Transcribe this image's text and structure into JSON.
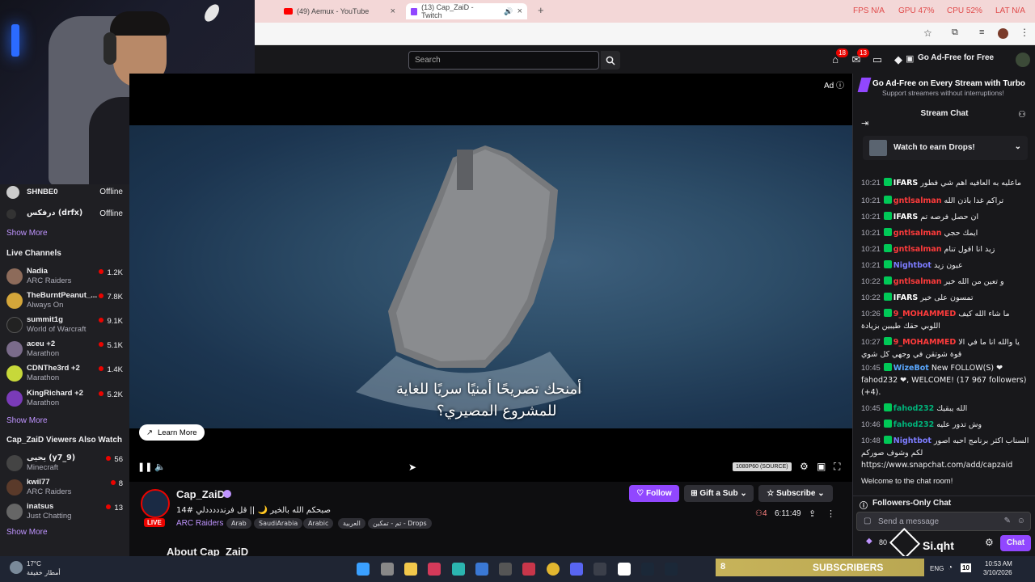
{
  "browser": {
    "tabs": [
      {
        "title": "(49) Aemux - YouTube"
      },
      {
        "title": "(13) Cap_ZaiD - Twitch"
      }
    ],
    "perf": {
      "fps": "FPS N/A",
      "gpu": "GPU 47%",
      "cpu": "CPU 52%",
      "lat": "LAT N/A"
    }
  },
  "header": {
    "search_placeholder": "Search",
    "notif_badge_1": "18",
    "notif_badge_2": "13",
    "adfree_label": "Go Ad-Free for Free"
  },
  "sidebar": {
    "followed": [
      {
        "name": "SHNBE0",
        "status": "Offline"
      },
      {
        "name": "درفكس (drfx)",
        "status": "Offline"
      }
    ],
    "show_more": "Show More",
    "live_heading": "Live Channels",
    "live": [
      {
        "name": "Nadia",
        "game": "ARC Raiders",
        "viewers": "1.2K"
      },
      {
        "name": "TheBurntPeanut_...",
        "game": "Always On",
        "viewers": "7.8K"
      },
      {
        "name": "summit1g",
        "game": "World of Warcraft",
        "viewers": "9.1K"
      },
      {
        "name": "aceu +2",
        "game": "Marathon",
        "viewers": "5.1K"
      },
      {
        "name": "CDNThe3rd +2",
        "game": "Marathon",
        "viewers": "1.4K"
      },
      {
        "name": "KingRichard +2",
        "game": "Marathon",
        "viewers": "5.2K"
      }
    ],
    "also_heading": "Cap_ZaiD Viewers Also Watch",
    "also": [
      {
        "name": "يحيى (y7_9)",
        "game": "Minecraft",
        "viewers": "56"
      },
      {
        "name": "kwil77",
        "game": "ARC Raiders",
        "viewers": "8"
      },
      {
        "name": "inatsus",
        "game": "Just Chatting",
        "viewers": "13"
      }
    ]
  },
  "player": {
    "ad_label": "Ad",
    "caption_line1": "أمنحك تصريحًا أمنيًا سريًا للغاية",
    "caption_line2": "للمشروع المصيري؟",
    "learn_more": "Learn More",
    "quality": "1080P60 (SOURCE)"
  },
  "channel": {
    "name": "Cap_ZaiD",
    "live": "LIVE",
    "title": "صبحكم الله بالخير 🌙 || قل فرندددددلي #14",
    "category": "ARC Raiders",
    "tags": [
      "Arab",
      "SaudiArabia",
      "Arabic",
      "العربية",
      "تم - تمكين - Drops"
    ],
    "follow": "Follow",
    "gift_sub": "Gift a Sub",
    "subscribe": "Subscribe",
    "viewers": "4",
    "uptime": "6:11:49",
    "about": "About Cap_ZaiD"
  },
  "chat": {
    "turbo_title": "Go Ad-Free on Every Stream with Turbo",
    "turbo_sub": "Support streamers without interruptions!",
    "title": "Stream Chat",
    "drops": "Watch to earn Drops!",
    "messages": [
      {
        "time": "10:21",
        "user": "IFARS",
        "color": "#ffffff",
        "text": "ماعليه به العافيه اهم شي فطور"
      },
      {
        "time": "10:21",
        "user": "gntlsalman",
        "color": "#ff3b3b",
        "text": "تراكم غدا باذن الله"
      },
      {
        "time": "10:21",
        "user": "IFARS",
        "color": "#ffffff",
        "text": "ان حصل فرصه تم"
      },
      {
        "time": "10:21",
        "user": "gntlsalman",
        "color": "#ff3b3b",
        "text": "ايمك حجي"
      },
      {
        "time": "10:21",
        "user": "gntlsalman",
        "color": "#ff3b3b",
        "text": "زيد انا اقول تنام"
      },
      {
        "time": "10:21",
        "user": "Nightbot",
        "color": "#7c7cff",
        "text": "عيون زيد"
      },
      {
        "time": "10:22",
        "user": "gntlsalman",
        "color": "#ff3b3b",
        "text": "و تعين من الله خير"
      },
      {
        "time": "10:22",
        "user": "IFARS",
        "color": "#ffffff",
        "text": "تمسون على خير"
      },
      {
        "time": "10:26",
        "user": "9_MOHAMMED",
        "color": "#ff3b3b",
        "text": "ما شاء الله كيف اللوبي حقك طيبين بزيادة"
      },
      {
        "time": "10:27",
        "user": "9_MOHAMMED",
        "color": "#ff3b3b",
        "text": "يا والله انا ما في الا قوة شوتقن في وجهي كل شوي"
      },
      {
        "time": "10:45",
        "user": "WizeBot",
        "color": "#5aa8ff",
        "text": "New FOLLOW(S) ❤ fahod232 ❤, WELCOME! (17 967 followers) (+4)."
      },
      {
        "time": "10:45",
        "user": "fahod232",
        "color": "#00b37a",
        "text": "الله يبقيك"
      },
      {
        "time": "10:46",
        "user": "fahod232",
        "color": "#00b37a",
        "text": "وش تدور عليه"
      },
      {
        "time": "10:48",
        "user": "Nightbot",
        "color": "#7c7cff",
        "text": "السناب اكثر برنامج احبه اصور لكم وشوف صوركم https://www.snapchat.com/add/capzaid"
      }
    ],
    "welcome": "Welcome to the chat room!",
    "followers_only": "Followers-Only Chat",
    "send_placeholder": "Send a message",
    "chat_button": "Chat",
    "overlay_text": "Si.qht",
    "overlay_count": "80"
  },
  "taskbar": {
    "weather_temp": "17°C",
    "weather_desc": "أمطار خفيفة",
    "subs_count": "8",
    "subs_label": "SUBSCRIBERS",
    "lang": "ENG",
    "time": "10:53 AM",
    "date": "3/10/2026",
    "notif": "10"
  }
}
